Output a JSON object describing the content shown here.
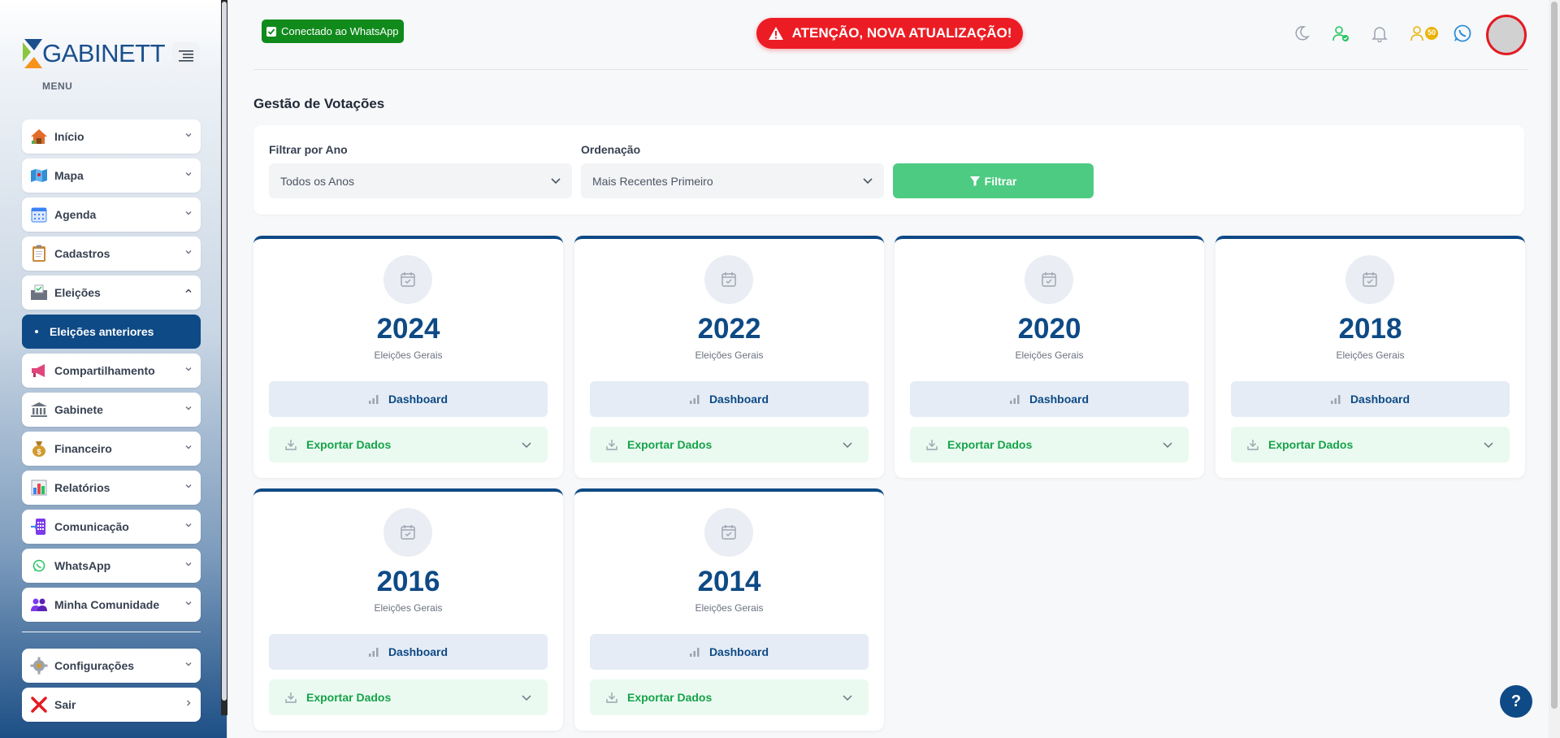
{
  "brand": {
    "logo_text": "GABINETT",
    "menu_label": "MENU"
  },
  "sidebar": {
    "items": [
      {
        "label": "Início",
        "icon": "home-icon",
        "color": "#e26b2b"
      },
      {
        "label": "Mapa",
        "icon": "map-icon",
        "color": "#2f8fd8"
      },
      {
        "label": "Agenda",
        "icon": "calendar-icon",
        "color": "#3b82f6"
      },
      {
        "label": "Cadastros",
        "icon": "clipboard-icon",
        "color": "#c98a3b"
      },
      {
        "label": "Eleições",
        "icon": "ballot-box-icon",
        "color": "#6b7280",
        "expanded": true
      }
    ],
    "active_sub": {
      "label": "Eleições anteriores"
    },
    "items_after": [
      {
        "label": "Compartilhamento",
        "icon": "megaphone-icon",
        "color": "#e0457b"
      },
      {
        "label": "Gabinete",
        "icon": "institution-icon",
        "color": "#6b7280"
      },
      {
        "label": "Financeiro",
        "icon": "money-bag-icon",
        "color": "#d29a2f"
      },
      {
        "label": "Relatórios",
        "icon": "bar-chart-icon",
        "color": "#3b82f6"
      },
      {
        "label": "Comunicação",
        "icon": "phone-icon",
        "color": "#7c3aed"
      },
      {
        "label": "WhatsApp",
        "icon": "whatsapp-icon",
        "color": "#22c55e"
      },
      {
        "label": "Minha Comunidade",
        "icon": "community-icon",
        "color": "#7c3aed"
      }
    ],
    "footer_items": [
      {
        "label": "Configurações",
        "icon": "gear-icon",
        "color": "#8b8b8b"
      },
      {
        "label": "Sair",
        "icon": "close-icon",
        "color": "#e31b23"
      }
    ]
  },
  "header": {
    "whatsapp_status": "Conectado ao WhatsApp",
    "alert": "ATENÇÃO, NOVA ATUALIZAÇÃO!",
    "badge_count": "50",
    "colors": {
      "alert": "#ec1c24",
      "whatsapp": "#118a1c"
    }
  },
  "page": {
    "title": "Gestão de Votações"
  },
  "filters": {
    "year_label": "Filtrar por Ano",
    "year_value": "Todos os Anos",
    "order_label": "Ordenação",
    "order_value": "Mais Recentes Primeiro",
    "filter_button": "Filtrar"
  },
  "elections": [
    {
      "year": "2024",
      "type": "Eleições Gerais",
      "dashboard": "Dashboard",
      "export": "Exportar Dados"
    },
    {
      "year": "2022",
      "type": "Eleições Gerais",
      "dashboard": "Dashboard",
      "export": "Exportar Dados"
    },
    {
      "year": "2020",
      "type": "Eleições Gerais",
      "dashboard": "Dashboard",
      "export": "Exportar Dados"
    },
    {
      "year": "2018",
      "type": "Eleições Gerais",
      "dashboard": "Dashboard",
      "export": "Exportar Dados"
    },
    {
      "year": "2016",
      "type": "Eleições Gerais",
      "dashboard": "Dashboard",
      "export": "Exportar Dados"
    },
    {
      "year": "2014",
      "type": "Eleições Gerais",
      "dashboard": "Dashboard",
      "export": "Exportar Dados"
    }
  ],
  "help": {
    "label": "?"
  }
}
